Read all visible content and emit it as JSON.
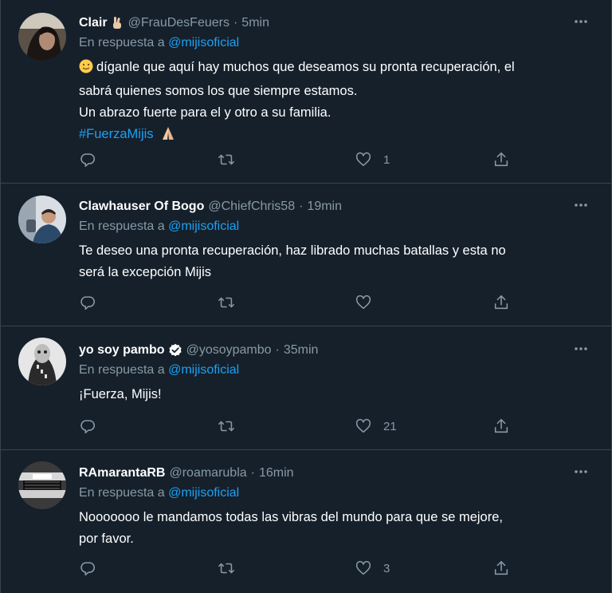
{
  "tweets": [
    {
      "name": "Clair",
      "name_emoji": "victory-hand-emoji",
      "handle": "@FrauDesFeuers",
      "time": "5min",
      "reply_prefix": "En respuesta a",
      "reply_to": "@mijisoficial",
      "lead_emoji": "slightly-smiling-face-emoji",
      "text_lines": [
        "díganle que aquí hay muchos que deseamos su pronta recuperación, el",
        "sabrá quienes somos los que siempre estamos.",
        "Un abrazo fuerte para el y otro a su familia."
      ],
      "hashtag": "#FuerzaMijis",
      "hashtag_emoji": "folded-hands-emoji",
      "likes": "1",
      "verified": false
    },
    {
      "name": "Clawhauser Of Bogo",
      "handle": "@ChiefChris58",
      "time": "19min",
      "reply_prefix": "En respuesta a",
      "reply_to": "@mijisoficial",
      "text_lines": [
        "Te deseo una pronta recuperación, haz librado muchas batallas y esta no",
        "será la excepción Mijis"
      ],
      "likes": "",
      "verified": false
    },
    {
      "name": "yo soy pambo",
      "handle": "@yosoypambo",
      "time": "35min",
      "reply_prefix": "En respuesta a",
      "reply_to": "@mijisoficial",
      "text_lines": [
        "¡Fuerza, Mijis!"
      ],
      "likes": "21",
      "verified": true
    },
    {
      "name": "RAmarantaRB",
      "handle": "@roamarubla",
      "time": "16min",
      "reply_prefix": "En respuesta a",
      "reply_to": "@mijisoficial",
      "text_lines": [
        "Nooooooo le mandamos todas las vibras del mundo para que se mejore,",
        "por favor."
      ],
      "likes": "3",
      "verified": false
    }
  ],
  "dot_separator": "·",
  "colors": {
    "background": "#15202b",
    "border": "#38444d",
    "secondary_text": "#8899a6",
    "accent": "#1da1f2",
    "verified_badge": "#ffffff"
  }
}
